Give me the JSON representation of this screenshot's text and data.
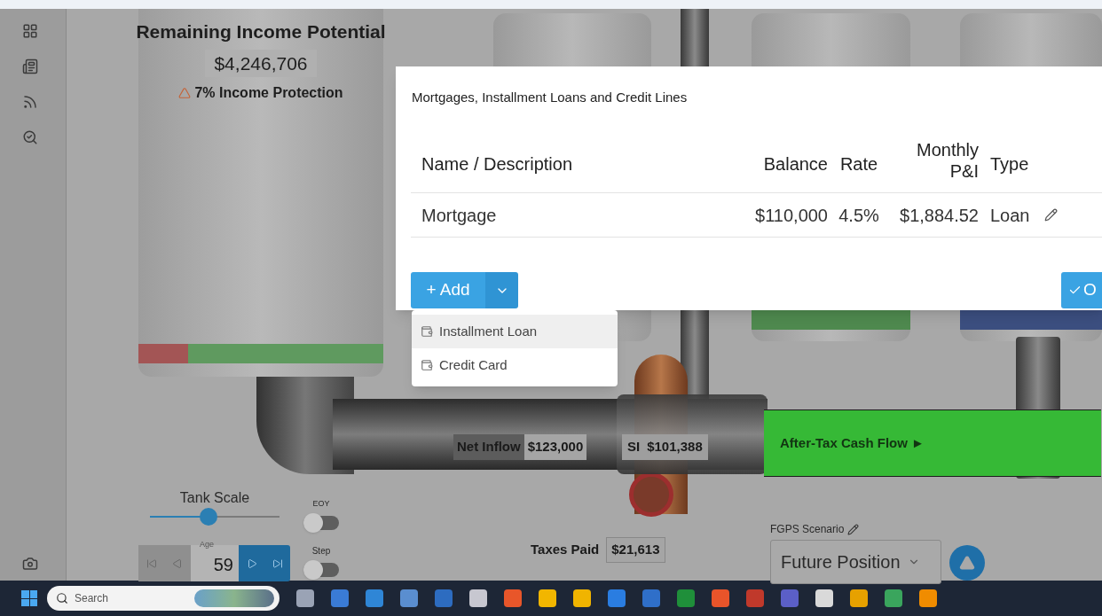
{
  "income_tank": {
    "title": "Remaining Income Potential",
    "amount": "$4,246,706",
    "protection": "7% Income Protection"
  },
  "flows": {
    "net_inflow": {
      "label": "Net Inflow",
      "value": "$123,000"
    },
    "si": {
      "label": "SI",
      "value": "$101,388"
    },
    "after_tax": "After-Tax Cash Flow ►",
    "taxes": {
      "label": "Taxes Paid",
      "value": "$21,613"
    }
  },
  "controls": {
    "tank_scale": {
      "label": "Tank Scale",
      "level": 0.45
    },
    "eoy": {
      "label": "EOY",
      "on": false
    },
    "step": {
      "label": "Step",
      "on": false
    },
    "age": {
      "label": "Age",
      "value": "59"
    }
  },
  "scenario": {
    "label": "FGPS Scenario",
    "value": "Future Position"
  },
  "dialog": {
    "title": "Mortgages, Installment Loans and Credit Lines",
    "columns": [
      "Name / Description",
      "Balance",
      "Rate",
      "Monthly P&I",
      "Type"
    ],
    "rows": [
      {
        "cells": [
          "Mortgage",
          "$110,000",
          "4.5%",
          "$1,884.52",
          "Loan"
        ]
      }
    ],
    "add_button": "+ Add",
    "ok_button": "O",
    "menu": [
      {
        "label": "Installment Loan",
        "selected": true
      },
      {
        "label": "Credit Card",
        "selected": false
      }
    ]
  },
  "taskbar": {
    "search_placeholder": "Search"
  }
}
